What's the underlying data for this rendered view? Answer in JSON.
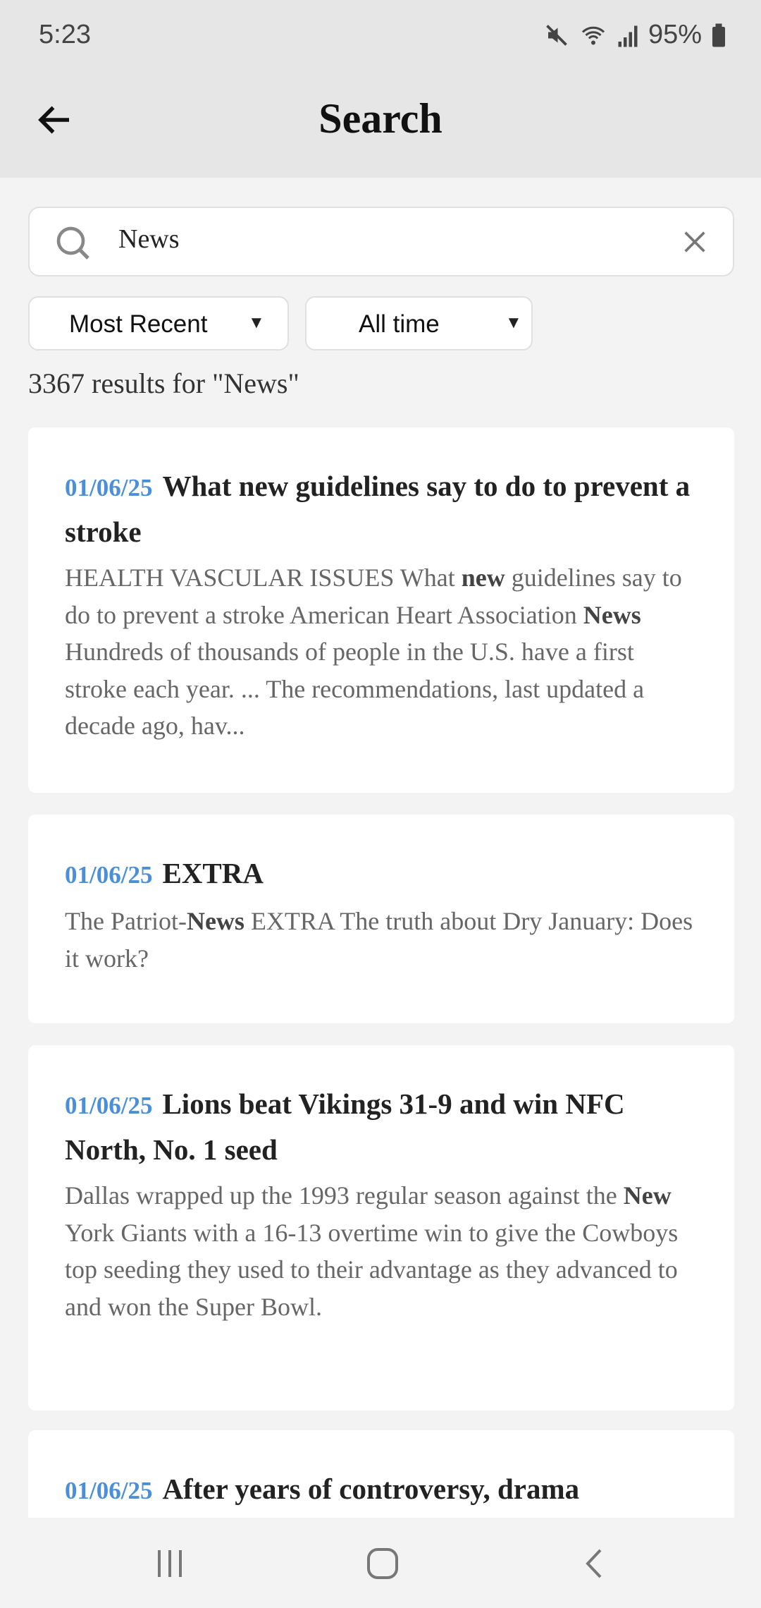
{
  "status": {
    "time": "5:23",
    "battery": "95%",
    "icons": [
      "mute-icon",
      "wifi-icon",
      "signal-icon",
      "battery-icon"
    ]
  },
  "header": {
    "title": "Search"
  },
  "search": {
    "value": "News",
    "placeholder": ""
  },
  "filters": {
    "sort": "Most Recent",
    "range": "All time"
  },
  "results_count": "3367 results for \"News\"",
  "colors": {
    "date": "#4a8fd8",
    "header_bg": "#e6e6e6"
  },
  "results": [
    {
      "date": "01/06/25",
      "title": "What new guidelines say to do to prevent a stroke",
      "snippet": [
        [
          "HEALTH VASCULAR ISSUES What ",
          false
        ],
        [
          "new",
          true
        ],
        [
          " guidelines say to do to prevent a stroke American Heart Association ",
          false
        ],
        [
          "News",
          true
        ],
        [
          " Hundreds of thousands of people in the U.S. have a first stroke each year. ... The recommendations, last updated a decade ago, hav...",
          false
        ]
      ]
    },
    {
      "date": "01/06/25",
      "title": "EXTRA",
      "snippet": [
        [
          "The Patriot-",
          false
        ],
        [
          "News",
          true
        ],
        [
          " EXTRA The truth about Dry January: Does it work?",
          false
        ]
      ]
    },
    {
      "date": "01/06/25",
      "title": "Lions beat Vikings 31-9 and win NFC North, No. 1 seed",
      "snippet": [
        [
          "Dallas wrapped up the 1993 regular season against the ",
          false
        ],
        [
          "New",
          true
        ],
        [
          " York Giants with a 16-13 overtime win to give the Cowboys top seeding they used to their advantage as they advanced to and won the Super Bowl.",
          false
        ]
      ]
    },
    {
      "date": "01/06/25",
      "title": "After years of controversy, drama",
      "snippet": []
    }
  ]
}
